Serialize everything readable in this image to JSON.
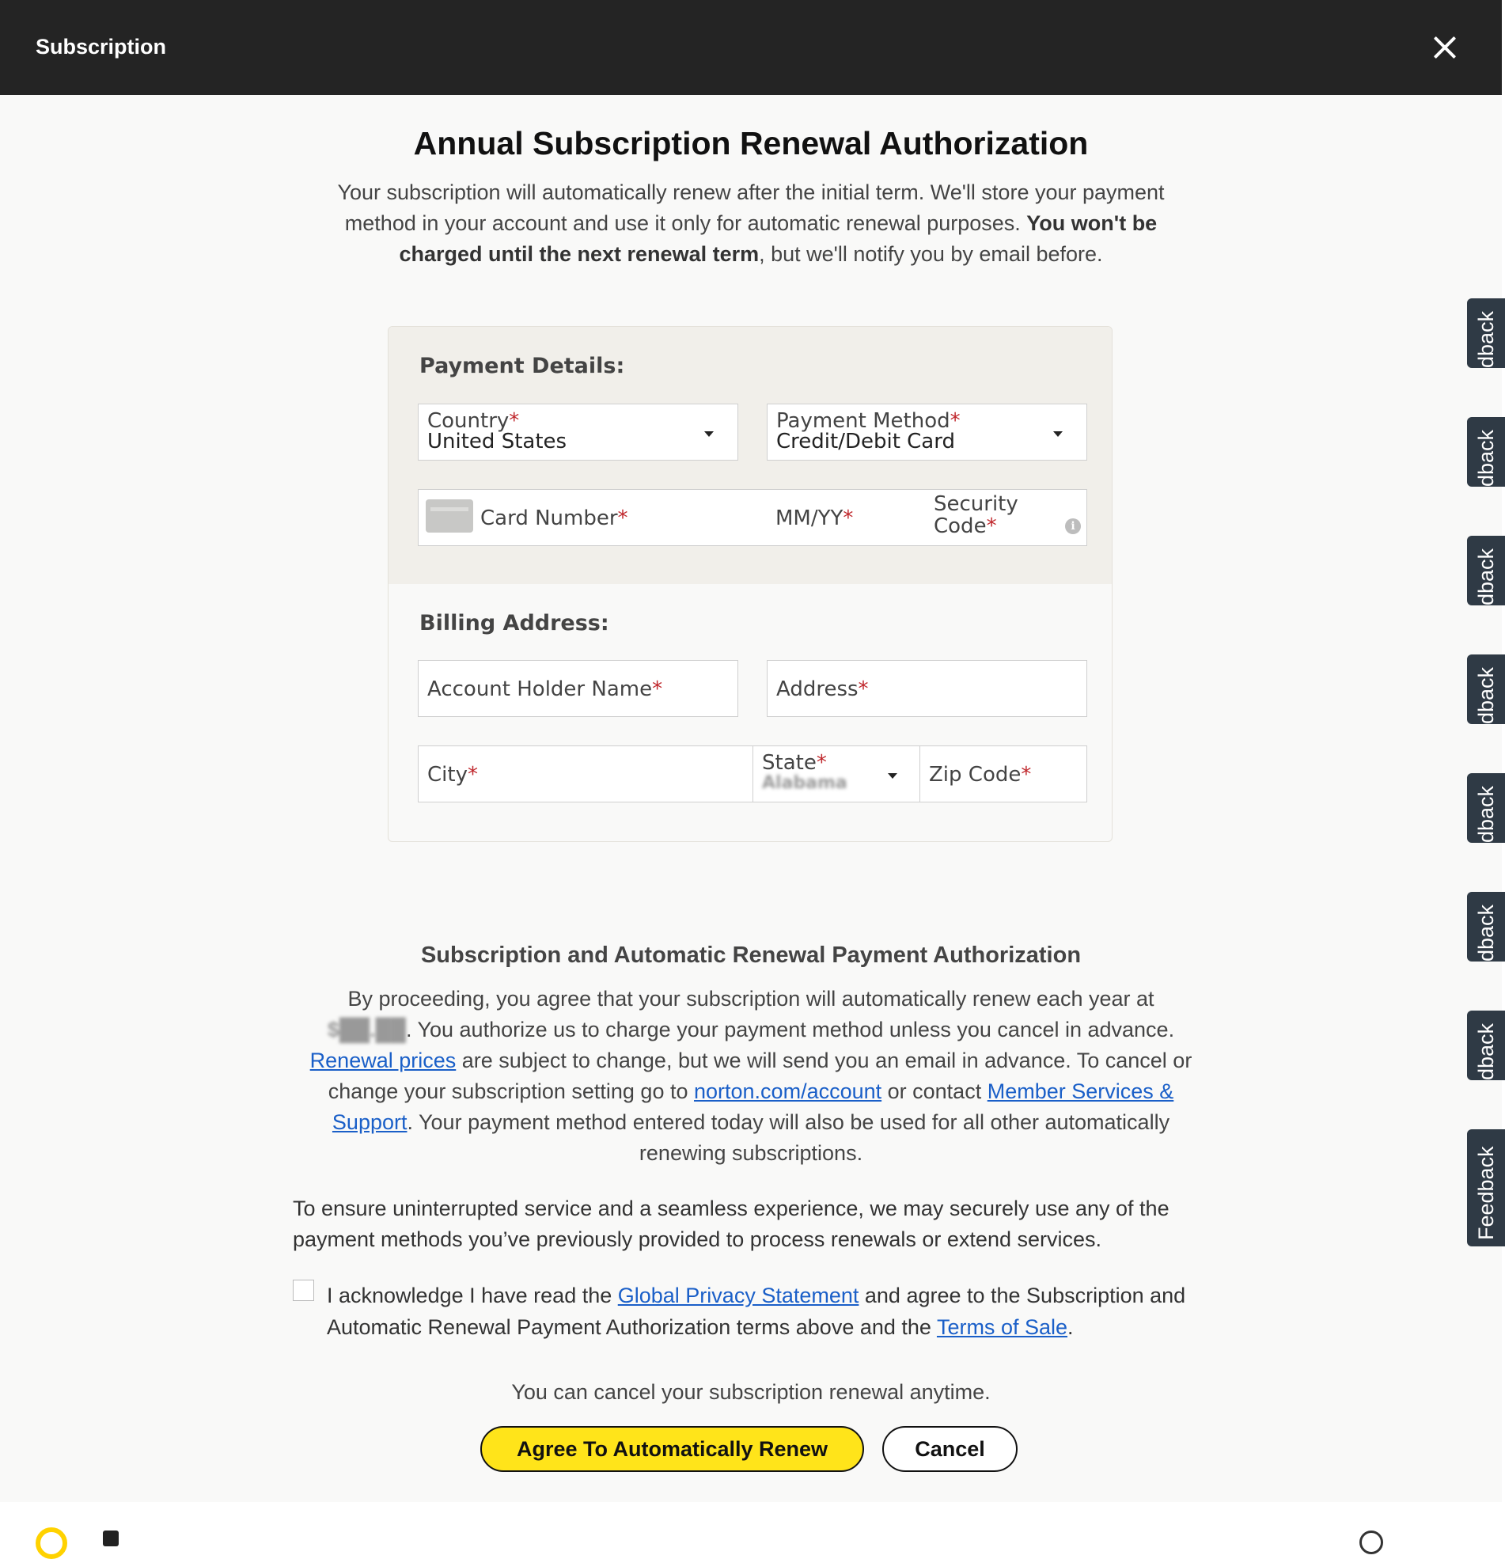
{
  "header": {
    "title": "Subscription"
  },
  "main": {
    "title": "Annual Subscription Renewal Authorization",
    "intro_1": "Your subscription will automatically renew after the initial term. We'll store your payment method in your account and use it only for automatic renewal purposes.",
    "intro_bold": "You won't be charged until the next renewal term",
    "intro_2": ", but we'll notify you by email before."
  },
  "payment": {
    "section_title": "Payment Details:",
    "country_label": "Country",
    "country_value": "United States",
    "method_label": "Payment Method",
    "method_value": "Credit/Debit Card",
    "card_number_label": "Card Number",
    "expiry_label": "MM/YY",
    "security_label_1": "Security",
    "security_label_2": "Code",
    "required_mark": "*"
  },
  "billing": {
    "section_title": "Billing Address:",
    "name_label": "Account Holder Name",
    "address_label": "Address",
    "city_label": "City",
    "state_label": "State",
    "state_value": "Alabama",
    "zip_label": "Zip Code"
  },
  "authorization": {
    "title": "Subscription and Automatic Renewal Payment Authorization",
    "p1": "By proceeding, you agree that your subscription will automatically renew each year at",
    "price": "$██.██",
    "p2": ". You authorize us to charge your payment method unless you cancel in advance.",
    "renewal_link": "Renewal prices",
    "p3": " are subject to change, but we will send you an email in advance. To cancel or change your subscription setting go to ",
    "account_link": "norton.com/account",
    "p4": " or contact ",
    "support_link": "Member Services & Support",
    "p5": ". Your payment method entered today will also be used for all other automatically renewing subscriptions."
  },
  "ensure_text": "To ensure uninterrupted service and a seamless experience, we may securely use any of the payment methods you’ve previously provided to process renewals or extend services.",
  "acknowledge": {
    "t1": "I acknowledge I have read the ",
    "privacy_link": "Global Privacy Statement",
    "t2": " and agree to the Subscription and Automatic Renewal Payment Authorization terms above and the ",
    "terms_link": "Terms of Sale",
    "t3": "."
  },
  "cancel_note": "You can cancel your subscription renewal anytime.",
  "buttons": {
    "agree": "Agree To Automatically Renew",
    "cancel": "Cancel"
  },
  "feedback": {
    "partial": "dback",
    "full": "Feedback"
  },
  "colors": {
    "topbar": "#242424",
    "accent": "#ffe41a",
    "link": "#1a5fc8",
    "required": "#c0282d",
    "feedback_tab": "#2f3a45"
  }
}
